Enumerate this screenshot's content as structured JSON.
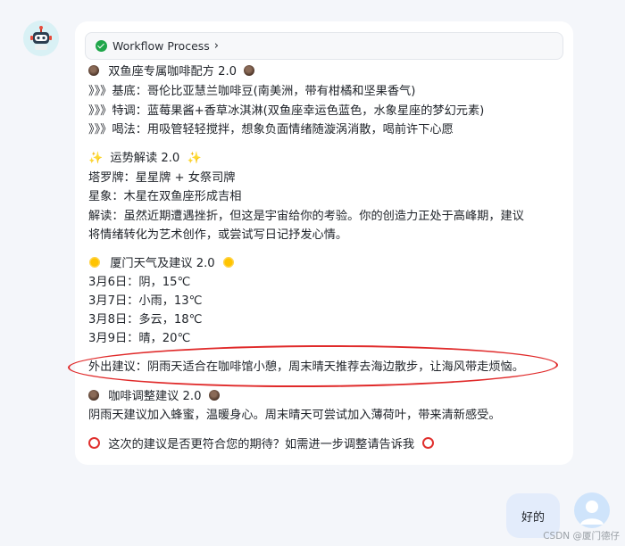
{
  "workflow": {
    "label": "Workflow Process"
  },
  "recipe": {
    "title": "双鱼座专属咖啡配方 2.0",
    "base": "》》》基底：哥伦比亚慧兰咖啡豆(南美洲，带有柑橘和坚果香气)",
    "special": "》》》特调：蓝莓果酱+香草冰淇淋(双鱼座幸运色蓝色，水象星座的梦幻元素)",
    "drink": "》》》喝法：用吸管轻轻搅拌，想象负面情绪随漩涡消散，喝前许下心愿"
  },
  "fortune": {
    "title": "运势解读 2.0",
    "tarot": "塔罗牌：星星牌 + 女祭司牌",
    "astro": "星象：木星在双鱼座形成吉相",
    "reading1": "解读：虽然近期遭遇挫折，但这是宇宙给你的考验。你的创造力正处于高峰期，建议",
    "reading2": "将情绪转化为艺术创作，或尝试写日记抒发心情。"
  },
  "weather": {
    "title": "厦门天气及建议 2.0",
    "days": [
      "3月6日：阴，15℃",
      "3月7日：小雨，13℃",
      "3月8日：多云，18℃",
      "3月9日：晴，20℃"
    ],
    "advice": "外出建议：阴雨天适合在咖啡馆小憩，周末晴天推荐去海边散步，让海风带走烦恼。"
  },
  "adjust": {
    "title": "咖啡调整建议 2.0",
    "text": "阴雨天建议加入蜂蜜，温暖身心。周末晴天可尝试加入薄荷叶，带来清新感受。"
  },
  "closing": "这次的建议是否更符合您的期待？如需进一步调整请告诉我",
  "user_message": "好的",
  "watermark": "CSDN @厦门德仔",
  "colors": {
    "annotation": "#e02a2a",
    "check": "#1fa64a",
    "user_bubble": "#e3ecfb"
  }
}
